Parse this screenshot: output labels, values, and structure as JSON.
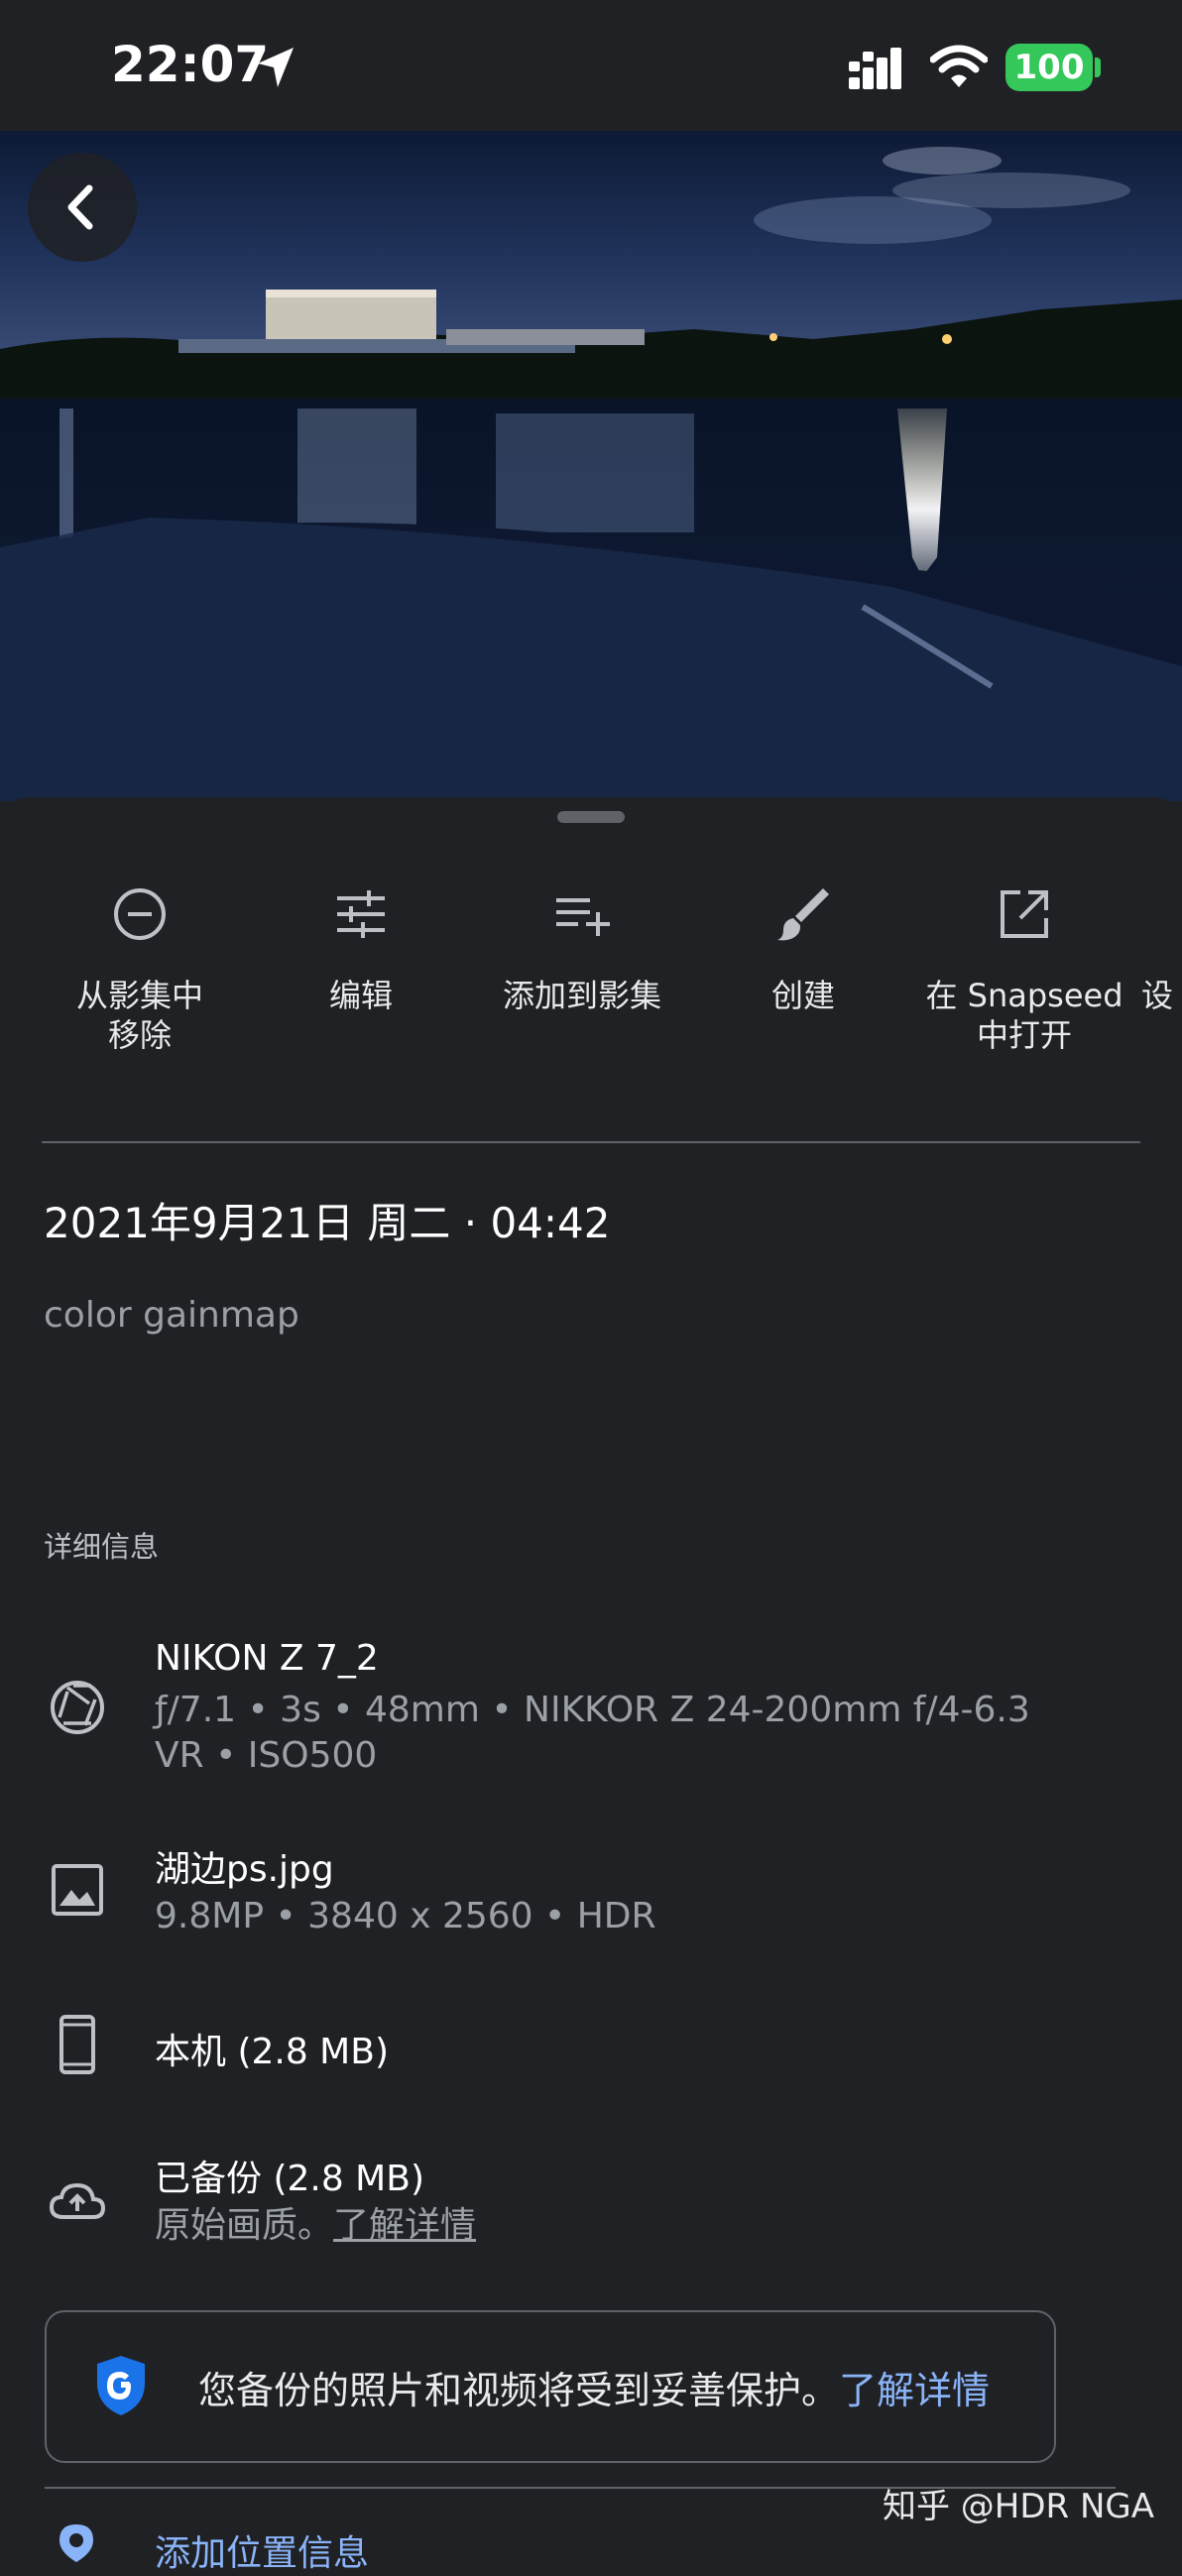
{
  "status_bar": {
    "time": "22:07",
    "battery": "100"
  },
  "actions": [
    {
      "label": "从影集中\n移除",
      "icon": "minus-circle-icon"
    },
    {
      "label": "编辑",
      "icon": "sliders-icon"
    },
    {
      "label": "添加到影集",
      "icon": "playlist-add-icon"
    },
    {
      "label": "创建",
      "icon": "brush-icon"
    },
    {
      "label": "在 Snapseed\n中打开",
      "icon": "open-external-icon"
    },
    {
      "label": "设",
      "icon": ""
    }
  ],
  "datetime": "2021年9月21日 周二 · 04:42",
  "caption": "color gainmap",
  "details_title": "详细信息",
  "camera": {
    "model": "NIKON Z 7_2",
    "specs_line1": "ƒ/7.1 • 3s • 48mm • NIKKOR Z 24-200mm f/4-6.3",
    "specs_line2": "VR • ISO500"
  },
  "file": {
    "name": "湖边ps.jpg",
    "info": "9.8MP • 3840 x 2560 • HDR"
  },
  "device": {
    "label": "本机 (2.8 MB)"
  },
  "backup": {
    "title": "已备份 (2.8 MB)",
    "quality": "原始画质。",
    "learn_more": "了解详情"
  },
  "protection": {
    "text": "您备份的照片和视频将受到妥善保护。",
    "link": "了解详情"
  },
  "add_location": "添加位置信息",
  "watermark": "知乎 @HDR NGA",
  "colors": {
    "background": "#202124",
    "accent": "#8ab4f8",
    "battery": "#34c759",
    "shield": "#1a73e8"
  }
}
